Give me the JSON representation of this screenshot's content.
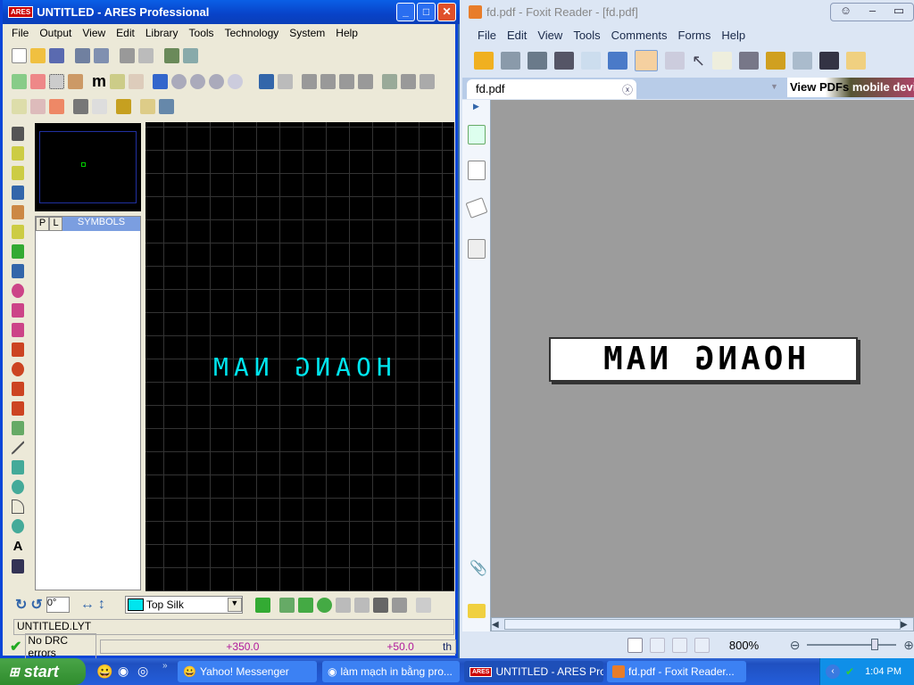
{
  "ares": {
    "title": "UNTITLED - ARES Professional",
    "logo": "ARES",
    "menu": [
      "File",
      "Output",
      "View",
      "Edit",
      "Library",
      "Tools",
      "Technology",
      "System",
      "Help"
    ],
    "selector": {
      "tab_p": "P",
      "tab_l": "L",
      "header": "SYMBOLS"
    },
    "canvas_text": "HOANG NAM",
    "rotation": "0°",
    "layer": "Top Silk",
    "filename": "UNTITLED.LYT",
    "drc": "No DRC errors",
    "coord_x": "+350.0",
    "coord_y": "+50.0",
    "units": "th",
    "colors": {
      "canvas_text": "#00e5ee",
      "coords": "#b0189c"
    }
  },
  "foxit": {
    "title": "fd.pdf - Foxit Reader - [fd.pdf]",
    "menu": [
      "File",
      "Edit",
      "View",
      "Tools",
      "Comments",
      "Forms",
      "Help"
    ],
    "tab": "fd.pdf",
    "ad_bold": "View PDFs",
    "ad_rest": "mobile device",
    "page_text": "HOANG NAM",
    "zoom": "800%"
  },
  "taskbar": {
    "start": "start",
    "items": [
      "Yahoo! Messenger",
      "làm mạch in bằng pro...",
      "UNTITLED - ARES Pro...",
      "fd.pdf - Foxit Reader..."
    ],
    "clock": "1:04 PM"
  }
}
